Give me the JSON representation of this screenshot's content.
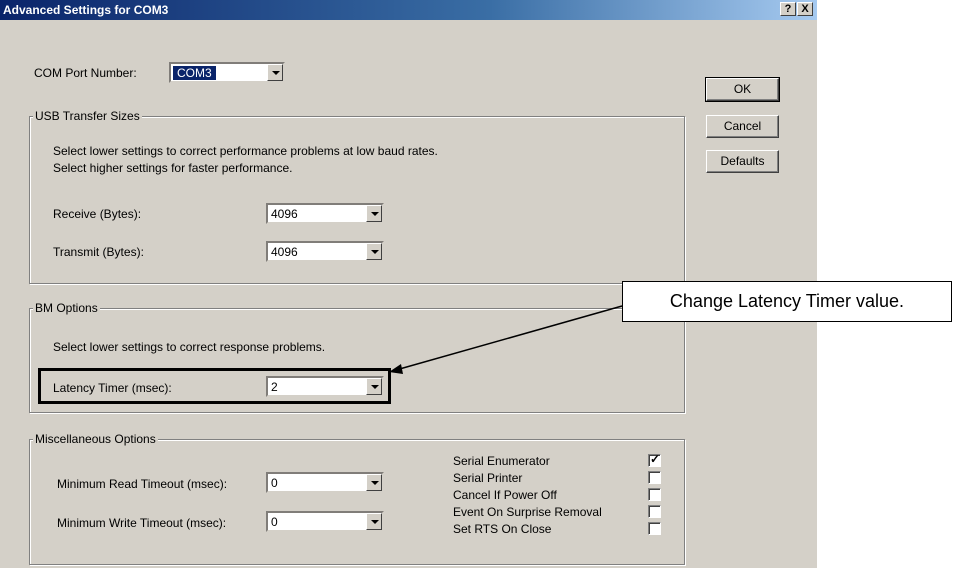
{
  "window": {
    "title": "Advanced Settings for COM3",
    "help_btn": "?",
    "close_btn": "X"
  },
  "com_port": {
    "label": "COM Port Number:",
    "value": "COM3"
  },
  "buttons": {
    "ok": "OK",
    "cancel": "Cancel",
    "defaults": "Defaults"
  },
  "usb": {
    "legend": "USB Transfer Sizes",
    "desc1": "Select lower settings to correct performance problems at low baud rates.",
    "desc2": "Select higher settings for faster performance.",
    "receive_label": "Receive (Bytes):",
    "receive_value": "4096",
    "transmit_label": "Transmit (Bytes):",
    "transmit_value": "4096"
  },
  "bm": {
    "legend": "BM Options",
    "desc": "Select lower settings to correct response problems.",
    "latency_label": "Latency Timer (msec):",
    "latency_value": "2"
  },
  "misc": {
    "legend": "Miscellaneous Options",
    "min_read_label": "Minimum Read Timeout (msec):",
    "min_read_value": "0",
    "min_write_label": "Minimum Write Timeout (msec):",
    "min_write_value": "0",
    "options": [
      {
        "label": "Serial Enumerator",
        "checked": true
      },
      {
        "label": "Serial Printer",
        "checked": false
      },
      {
        "label": "Cancel If Power Off",
        "checked": false
      },
      {
        "label": "Event On Surprise Removal",
        "checked": false
      },
      {
        "label": "Set RTS On Close",
        "checked": false
      }
    ]
  },
  "annotation": {
    "text": "Change Latency Timer value."
  }
}
